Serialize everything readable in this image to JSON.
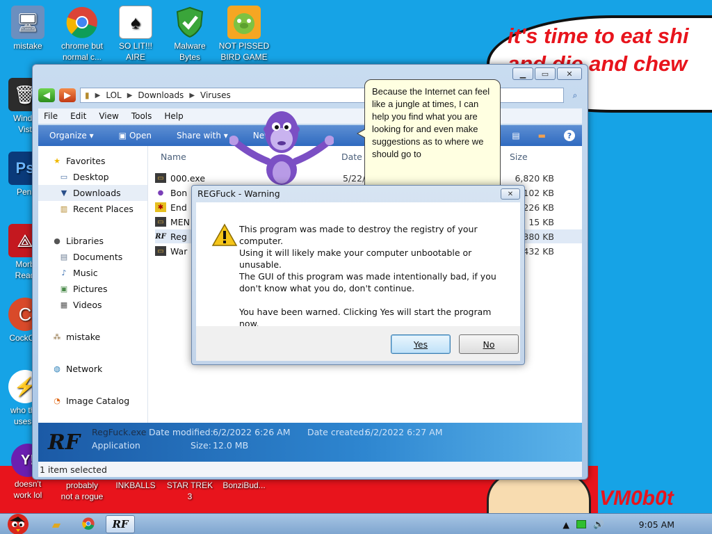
{
  "desktop": {
    "icons": [
      {
        "label": "mistake",
        "icon": "computer-warning-icon"
      },
      {
        "label": "chrome but\nnormal c...",
        "icon": "chrome-icon"
      },
      {
        "label": "SO LIT!!!\nAIRE",
        "icon": "solitaire-icon"
      },
      {
        "label": "Malware\nBytes",
        "icon": "shield-check-icon"
      },
      {
        "label": "NOT PISSED\nBIRD GAME",
        "icon": "pig-icon"
      },
      {
        "label": "Windo\nVist",
        "icon": "trash-icon"
      },
      {
        "label": "Peni",
        "icon": "photoshop-icon"
      },
      {
        "label": "Morb\nRead",
        "icon": "pdf-icon"
      },
      {
        "label": "CockCle",
        "icon": "ccleaner-icon"
      },
      {
        "label": "who the\nuses t",
        "icon": "flash-icon"
      },
      {
        "label": "doesn't\nwork lol",
        "icon": "yahoo-icon"
      },
      {
        "label": "probably\nnot a rogue",
        "icon": "app-icon"
      },
      {
        "label": "INKBALLS",
        "icon": "game-icon"
      },
      {
        "label": "STAR TREK\n3",
        "icon": "game-icon"
      },
      {
        "label": "BonziBud...",
        "icon": "app-icon"
      }
    ],
    "wall_speech": "it's time to eat shi\nand die and chew\n gum",
    "signature": "VM0b0t"
  },
  "explorer": {
    "breadcrumb": [
      "LOL",
      "Downloads",
      "Viruses"
    ],
    "menu": [
      "File",
      "Edit",
      "View",
      "Tools",
      "Help"
    ],
    "toolbar": {
      "organize": "Organize ▾",
      "open": "Open",
      "share": "Share with ▾",
      "new": "New"
    },
    "nav": {
      "favorites": "Favorites",
      "desktop": "Desktop",
      "downloads": "Downloads",
      "recent": "Recent Places",
      "libraries": "Libraries",
      "documents": "Documents",
      "music": "Music",
      "pictures": "Pictures",
      "videos": "Videos",
      "mistake": "mistake",
      "network": "Network",
      "image_catalog": "Image Catalog"
    },
    "columns": {
      "name": "Name",
      "date": "Date",
      "size": "Size"
    },
    "files": [
      {
        "name": "000.exe",
        "date": "5/22/",
        "size": "6,820 KB",
        "icon": "exe-icon"
      },
      {
        "name": "Bon",
        "date": "",
        "size": "102 KB",
        "icon": "bonzi-icon"
      },
      {
        "name": "End",
        "date": "",
        "size": "226 KB",
        "icon": "app-icon"
      },
      {
        "name": "MEN",
        "date": "",
        "size": "15 KB",
        "icon": "exe-icon"
      },
      {
        "name": "Reg",
        "date": "",
        "size": "380 KB",
        "icon": "regfuck-icon"
      },
      {
        "name": "War",
        "date": "",
        "size": "432 KB",
        "icon": "exe-icon"
      }
    ],
    "details": {
      "filename": "RegFuck.exe",
      "modified_label": "Date modified:",
      "modified": "6/2/2022 6:26 AM",
      "created_label": "Date created:",
      "created": "6/2/2022 6:27 AM",
      "type": "Application",
      "size_label": "Size:",
      "size": "12.0 MB",
      "logo": "RF"
    },
    "status": "1 item selected"
  },
  "balloon": {
    "text": "Because the Internet can feel like a jungle at times, I can help you find what you are looking for and even make suggestions as to where we should go to"
  },
  "dialog": {
    "title": "REGFuck - Warning",
    "message": "This program was made to destroy the registry of your computer.\nUsing it will likely make your computer unbootable or unusable.\nThe GUI of this program was made intentionally bad, if you don't know what you do, don't continue.\n\nYou have been warned. Clicking Yes will start the program now.",
    "yes": "Yes",
    "no": "No"
  },
  "taskbar": {
    "time": "9:05 AM"
  }
}
